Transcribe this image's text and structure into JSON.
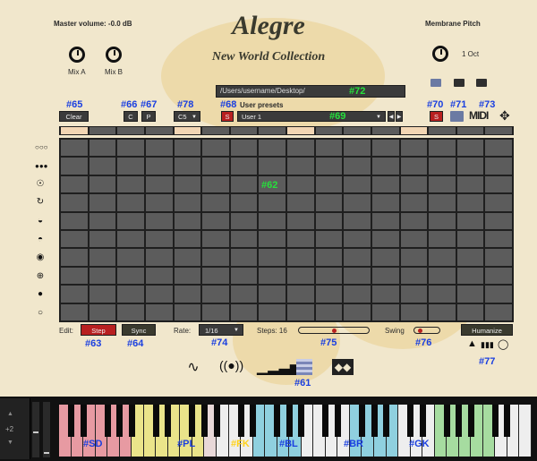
{
  "header": {
    "title": "Alegre",
    "subtitle": "New World Collection",
    "master_volume": "Master volume: -0.0 dB",
    "knob_left_a": "Mix A",
    "knob_left_b": "Mix B",
    "right_title": "Membrane Pitch",
    "pitch_value": "1 Oct"
  },
  "toolbar": {
    "path": "/Users/username/Desktop/",
    "user_presets": "User presets",
    "preset_name": "User 1",
    "clear": "Clear",
    "c": "C",
    "p": "P",
    "key": "C5",
    "s_left": "S",
    "s_right": "S",
    "midi": "MIDI"
  },
  "controls": {
    "edit_label": "Edit:",
    "step": "Step",
    "sync": "Sync",
    "rate_label": "Rate:",
    "rate_value": "1/16",
    "steps_label": "Steps: 16",
    "swing_label": "Swing",
    "humanize": "Humanize",
    "steps_value": 16,
    "steps_max": 32,
    "swing_value": 0.1
  },
  "annotations": {
    "a65": "#65",
    "a66": "#66",
    "a67": "#67",
    "a78": "#78",
    "a68": "#68",
    "a72": "#72",
    "a69": "#69",
    "a70": "#70",
    "a71": "#71",
    "a73": "#73",
    "a62": "#62",
    "a63": "#63",
    "a64": "#64",
    "a74": "#74",
    "a75": "#75",
    "a76": "#76",
    "a77": "#77",
    "a61": "#61",
    "sd": "#SD",
    "pl": "#PL",
    "fk": "#FK",
    "bl": "#BL",
    "br": "#BR",
    "gk": "#GK"
  },
  "keyboard": {
    "octave": "+2"
  },
  "colors": {
    "accent_red": "#b82020",
    "annotation_blue": "#1a3fe0",
    "annotation_green": "#26e03b",
    "annotation_yellow": "#ffd21a",
    "step_active": "#f2d6b4"
  },
  "icons": {
    "row_icons": [
      "three-empty-circles-icon",
      "three-filled-circles-icon",
      "dot-ring-icon",
      "circle-arrow-icon",
      "half-filled-circle-icon",
      "half-circle-icon",
      "target-circle-icon",
      "crosshair-circle-icon",
      "filled-circle-icon",
      "empty-circle-icon"
    ],
    "bottom_icons": [
      "curve-icon",
      "speaker-waves-icon",
      "bars-icon",
      "pattern-grid-icon",
      "diamond-box-icon"
    ]
  }
}
